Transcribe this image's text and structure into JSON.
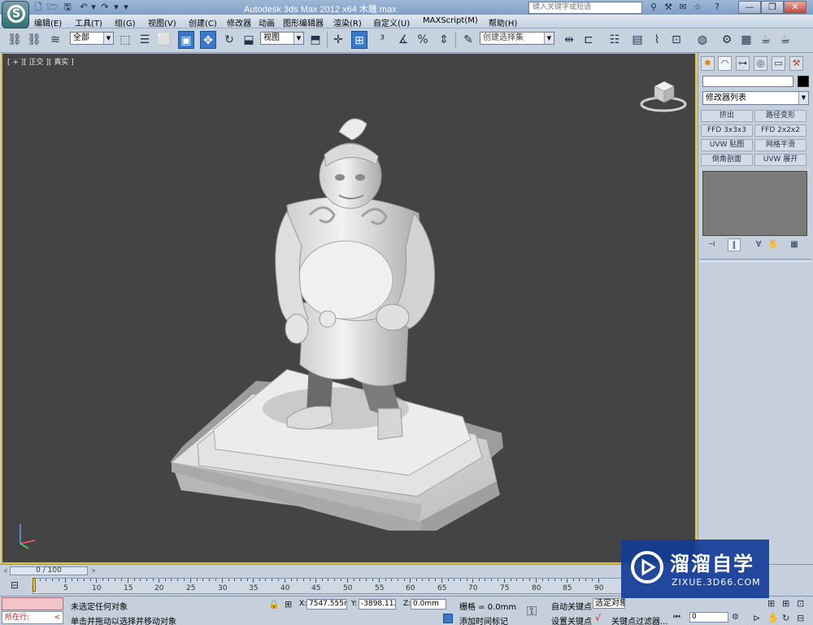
{
  "window": {
    "title": "Autodesk 3ds Max  2012 x64     木雕.max",
    "search_placeholder": "键入关键字或短语",
    "min": "—",
    "max": "❐",
    "close": "✕"
  },
  "menu": [
    "编辑(E)",
    "工具(T)",
    "组(G)",
    "视图(V)",
    "创建(C)",
    "修改器",
    "动画",
    "图形编辑器",
    "渲染(R)",
    "自定义(U)",
    "MAXScript(M)",
    "帮助(H)"
  ],
  "toolbar": {
    "selection_filter": "全部",
    "reference_coord": "视图",
    "named_selection": "创建选择集"
  },
  "viewport": {
    "label": "[ + ][ 正交 ][ 真实 ]"
  },
  "command_panel": {
    "modifier_list": "修改器列表",
    "modifier_buttons": [
      "挤出",
      "路径变形",
      "FFD 3x3x3",
      "FFD 2x2x2",
      "UVW 贴图",
      "网格平滑",
      "倒角剖面",
      "UVW 展开"
    ]
  },
  "timeline": {
    "slider": "0 / 100",
    "prev": "<",
    "next": ">",
    "ticks": [
      "0",
      "5",
      "10",
      "15",
      "20",
      "25",
      "30",
      "35",
      "40",
      "45",
      "50",
      "55",
      "60",
      "65",
      "70",
      "75",
      "80",
      "85",
      "90"
    ]
  },
  "status": {
    "listener_prompt": "所在行:",
    "selection_info": "未选定任何对象",
    "prompt": "单击并拖动以选择并移动对象",
    "x_label": "X:",
    "x_value": "7547.555m",
    "y_label": "Y:",
    "y_value": "-3898.112m",
    "z_label": "Z:",
    "z_value": "0.0mm",
    "grid": "栅格 = 0.0mm",
    "add_time_tag": "添加时间标记",
    "auto_key": "自动关键点",
    "set_key": "设置关键点",
    "selected_object": "选定对象",
    "key_filters": "关键点过滤器...",
    "frame_value": "0"
  },
  "watermark": {
    "title": "溜溜自学",
    "url": "ZIXUE.3D66.COM"
  }
}
